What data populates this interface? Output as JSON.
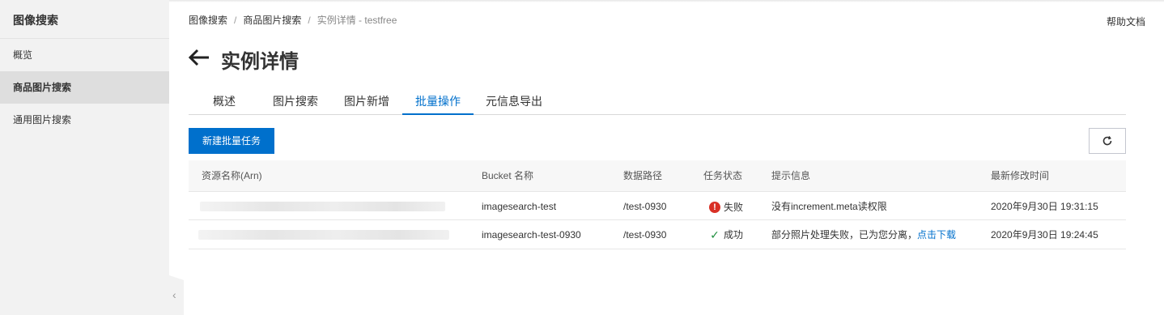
{
  "sidebar": {
    "title": "图像搜索",
    "items": [
      {
        "label": "概览",
        "active": false
      },
      {
        "label": "商品图片搜索",
        "active": true
      },
      {
        "label": "通用图片搜索",
        "active": false
      }
    ]
  },
  "breadcrumb": {
    "items": [
      "图像搜索",
      "商品图片搜索"
    ],
    "separator": "/",
    "current": "实例详情 - testfree"
  },
  "header": {
    "help_label": "帮助文档",
    "title": "实例详情"
  },
  "tabs": [
    {
      "label": "概述",
      "active": false
    },
    {
      "label": "图片搜索",
      "active": false
    },
    {
      "label": "图片新增",
      "active": false
    },
    {
      "label": "批量操作",
      "active": true
    },
    {
      "label": "元信息导出",
      "active": false
    }
  ],
  "toolbar": {
    "new_task_label": "新建批量任务",
    "refresh_icon": "refresh-icon"
  },
  "table": {
    "columns": [
      "资源名称(Arn)",
      "Bucket 名称",
      "数据路径",
      "任务状态",
      "提示信息",
      "最新修改时间"
    ],
    "rows": [
      {
        "arn": "",
        "bucket": "imagesearch-test",
        "path": "/test-0930",
        "status": "失败",
        "status_type": "error",
        "message": "没有increment.meta读权限",
        "message_link": "",
        "modified": "2020年9月30日 19:31:15"
      },
      {
        "arn": "",
        "bucket": "imagesearch-test-0930",
        "path": "/test-0930",
        "status": "成功",
        "status_type": "success",
        "message": "部分照片处理失败，已为您分离，",
        "message_link": "点击下载",
        "modified": "2020年9月30日 19:24:45"
      }
    ]
  },
  "colors": {
    "primary": "#0070cc",
    "error": "#d93026",
    "success": "#1e8e3e",
    "sidebar_bg": "#f2f2f2"
  }
}
